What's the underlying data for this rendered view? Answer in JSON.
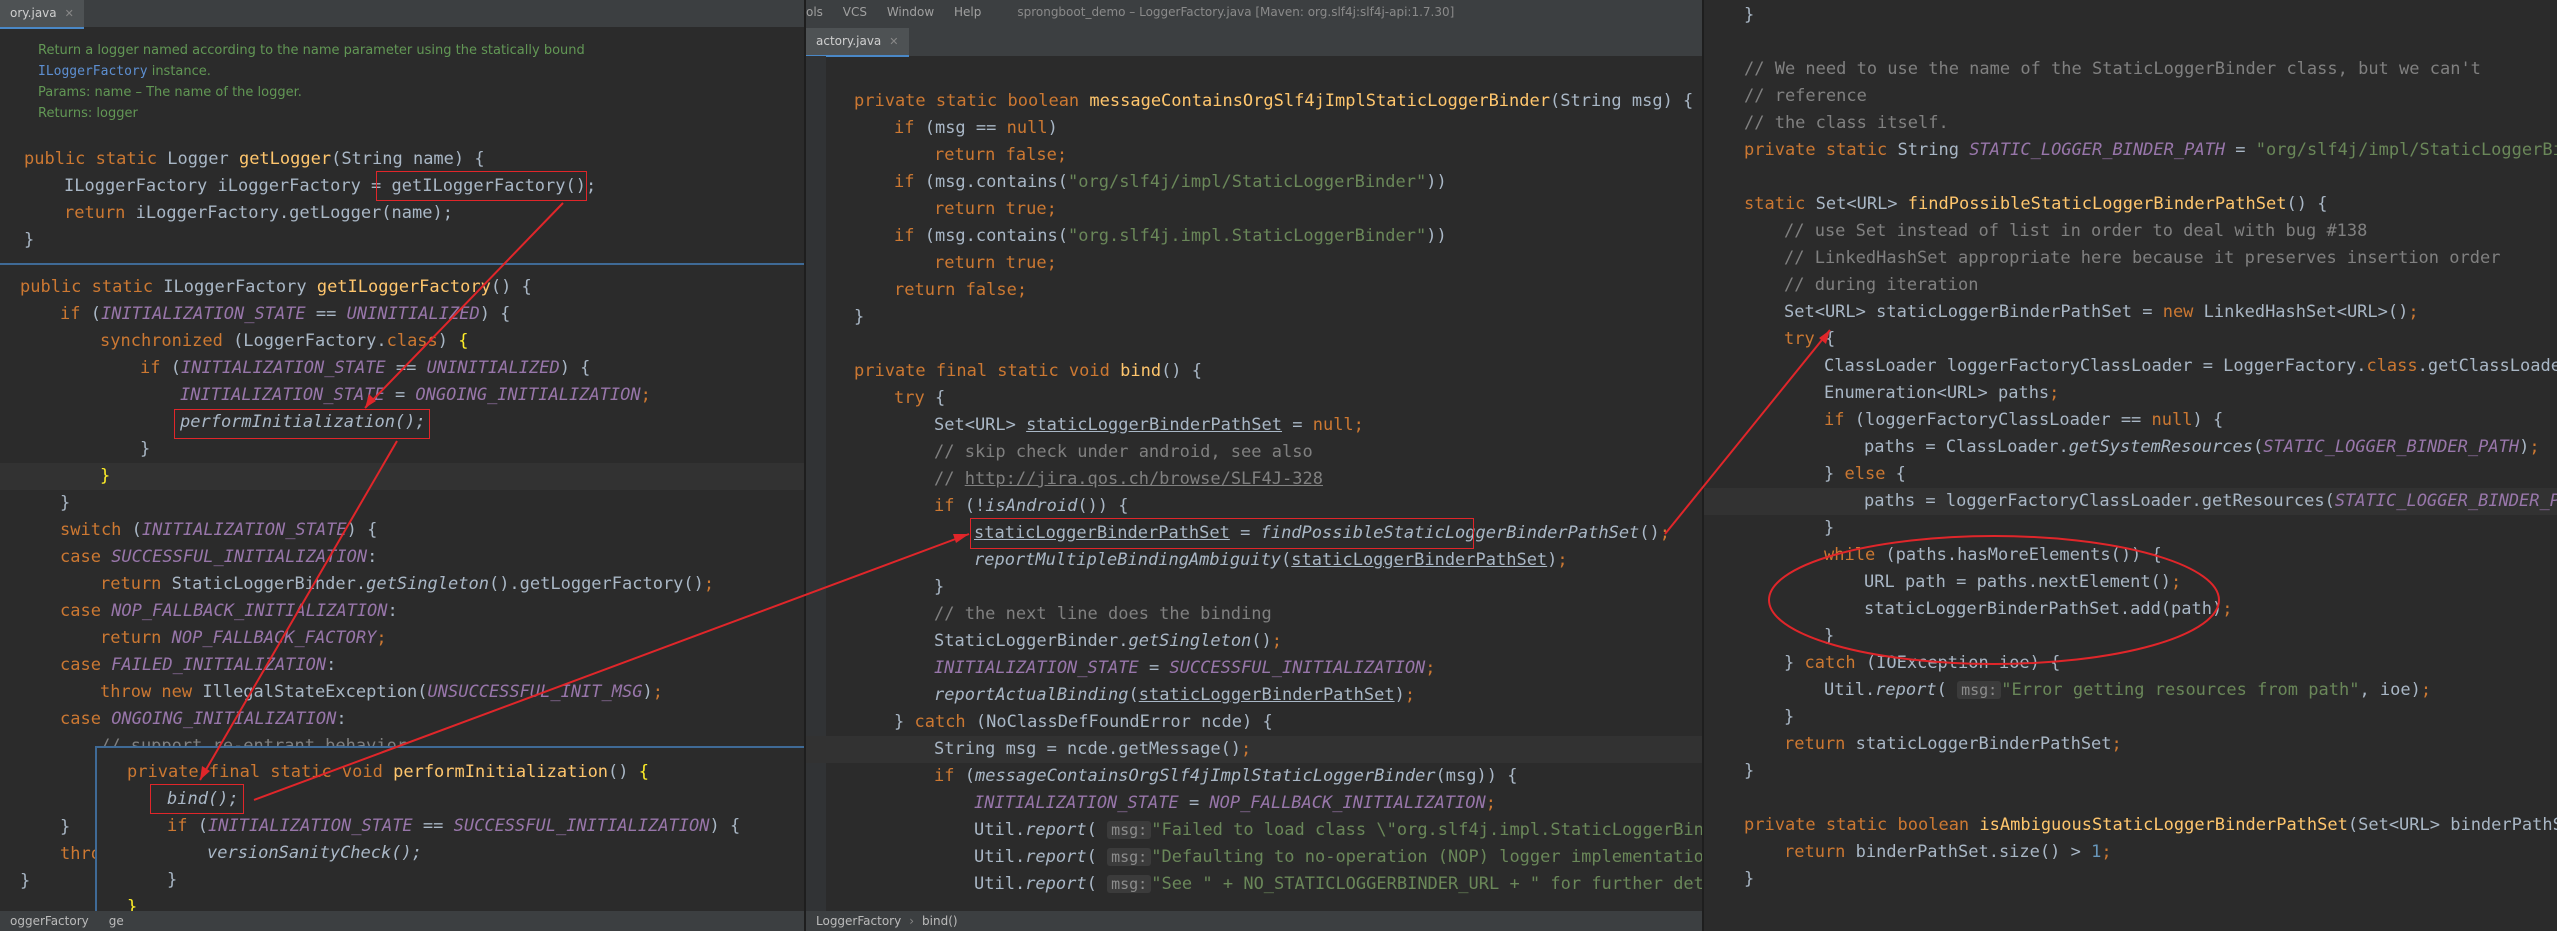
{
  "window": {
    "menu": [
      "ols",
      "VCS",
      "Window",
      "Help"
    ],
    "title": "sprongboot_demo – LoggerFactory.java [Maven: org.slf4j:slf4j-api:1.7.30]"
  },
  "tabs": {
    "left": "ory.java",
    "middle": "actory.java"
  },
  "doc": {
    "line1": "Return a logger named according to the name parameter using the statically bound",
    "line2_link": "ILoggerFactory",
    "line2_rest": " instance.",
    "params": "Params:  name – The name of the logger.",
    "returns": "Returns:  logger"
  },
  "footer": {
    "left": "oggerFactory",
    "left2": "ge",
    "middle_class": "LoggerFactory",
    "middle_method": "bind()"
  },
  "hints": {
    "msg": "msg:"
  },
  "code": {
    "left_a": {
      "l1": "public static Logger getLogger(String name) {",
      "l2a": "ILoggerFactory iLoggerFactory = ",
      "l2b": "getILoggerFactory();",
      "l3": "return iLoggerFactory.getLogger(name);",
      "l4": "}"
    },
    "left_b": {
      "l1": "public static ILoggerFactory getILoggerFactory() {",
      "l2": "if (INITIALIZATION_STATE == UNINITIALIZED) {",
      "l3": "synchronized (LoggerFactory.class) {",
      "l4": "if (INITIALIZATION_STATE == UNINITIALIZED) {",
      "l5": "INITIALIZATION_STATE = ONGOING_INITIALIZATION;",
      "l6": "performInitialization();",
      "l7": "}",
      "l8": "}",
      "l9": "}",
      "l10": "switch (INITIALIZATION_STATE) {",
      "l11": "case SUCCESSFUL_INITIALIZATION:",
      "l12": "return StaticLoggerBinder.getSingleton().getLoggerFactory();",
      "l13": "case NOP_FALLBACK_INITIALIZATION:",
      "l14": "return NOP_FALLBACK_FACTORY;",
      "l15": "case FAILED_INITIALIZATION:",
      "l16": "throw new IllegalStateException(UNSUCCESSFUL_INIT_MSG);",
      "l17": "case ONGOING_INITIALIZATION:",
      "l18": "// support re-entrant behavior.",
      "l19": "}",
      "l20": "thro",
      "l21": "}"
    },
    "left_c": {
      "l1": "private final static void performInitialization() {",
      "l2": "bind();",
      "l3": "if (INITIALIZATION_STATE == SUCCESSFUL_INITIALIZATION) {",
      "l4": "versionSanityCheck();",
      "l5": "}",
      "l6": "}"
    },
    "middle": {
      "l1": "private static boolean messageContainsOrgSlf4jImplStaticLoggerBinder(String msg) {",
      "l2": "if (msg == null)",
      "l3": "return false;",
      "l4": "if (msg.contains(\"org/slf4j/impl/StaticLoggerBinder\"))",
      "l5": "return true;",
      "l6": "if (msg.contains(\"org.slf4j.impl.StaticLoggerBinder\"))",
      "l7": "return true;",
      "l8": "return false;",
      "l9": "}",
      "l10": "private final static void bind() {",
      "l11": "try {",
      "l12": "Set<URL> staticLoggerBinderPathSet = null;",
      "l13": "// skip check under android, see also",
      "l14": "// http://jira.qos.ch/browse/SLF4J-328",
      "l15": "if (!isAndroid()) {",
      "l16": "staticLoggerBinderPathSet = findPossibleStaticLoggerBinderPathSet();",
      "l17": "reportMultipleBindingAmbiguity(staticLoggerBinderPathSet);",
      "l18": "}",
      "l19": "// the next line does the binding",
      "l20": "StaticLoggerBinder.getSingleton();",
      "l21": "INITIALIZATION_STATE = SUCCESSFUL_INITIALIZATION;",
      "l22": "reportActualBinding(staticLoggerBinderPathSet);",
      "l23": "} catch (NoClassDefFoundError ncde) {",
      "l24": "String msg = ncde.getMessage();",
      "l25": "if (messageContainsOrgSlf4jImplStaticLoggerBinder(msg)) {",
      "l26": "INITIALIZATION_STATE = NOP_FALLBACK_INITIALIZATION;",
      "l27": "\"Failed to load class \\\"org.slf4j.impl.StaticLoggerBinde",
      "l28": "\"Defaulting to no-operation (NOP) logger implementation\"",
      "l29": "\"See \" + NO_STATICLOGGERBINDER_URL + \" for further detai"
    },
    "right": {
      "l0": "}",
      "l1": "// We need to use the name of the StaticLoggerBinder class, but we can't",
      "l2": "// reference",
      "l3": "// the class itself.",
      "l4": "private static String STATIC_LOGGER_BINDER_PATH = \"org/slf4j/impl/StaticLoggerBind",
      "l5": "static Set<URL> findPossibleStaticLoggerBinderPathSet() {",
      "l6": "// use Set instead of list in order to deal with bug #138",
      "l7": "// LinkedHashSet appropriate here because it preserves insertion order",
      "l8": "// during iteration",
      "l9": "Set<URL> staticLoggerBinderPathSet = new LinkedHashSet<URL>();",
      "l10": "try {",
      "l11": "ClassLoader loggerFactoryClassLoader = LoggerFactory.class.getClassLoader",
      "l12": "Enumeration<URL> paths;",
      "l13": "if (loggerFactoryClassLoader == null) {",
      "l14": "paths = ClassLoader.getSystemResources(STATIC_LOGGER_BINDER_PATH);",
      "l15": "} else {",
      "l16": "paths = loggerFactoryClassLoader.getResources(STATIC_LOGGER_BINDER_PA",
      "l17": "}",
      "l18": "while (paths.hasMoreElements()) {",
      "l19": "URL path = paths.nextElement();",
      "l20": "staticLoggerBinderPathSet.add(path);",
      "l21": "}",
      "l22": "} catch (IOException ioe) {",
      "l23": "\"Error getting resources from path\", ioe);",
      "l24": "}",
      "l25": "return staticLoggerBinderPathSet;",
      "l26": "}",
      "l27": "private static boolean isAmbiguousStaticLoggerBinderPathSet(Set<URL> binderPathSe",
      "l28": "return binderPathSet.size() > 1;",
      "l29": "}"
    }
  },
  "colors": {
    "background": "#2b2b2b",
    "keyword": "#cc7832",
    "method": "#ffc66d",
    "string": "#6a8759",
    "comment": "#808080",
    "constant": "#9876aa",
    "annotation_red": "#e0262a"
  }
}
